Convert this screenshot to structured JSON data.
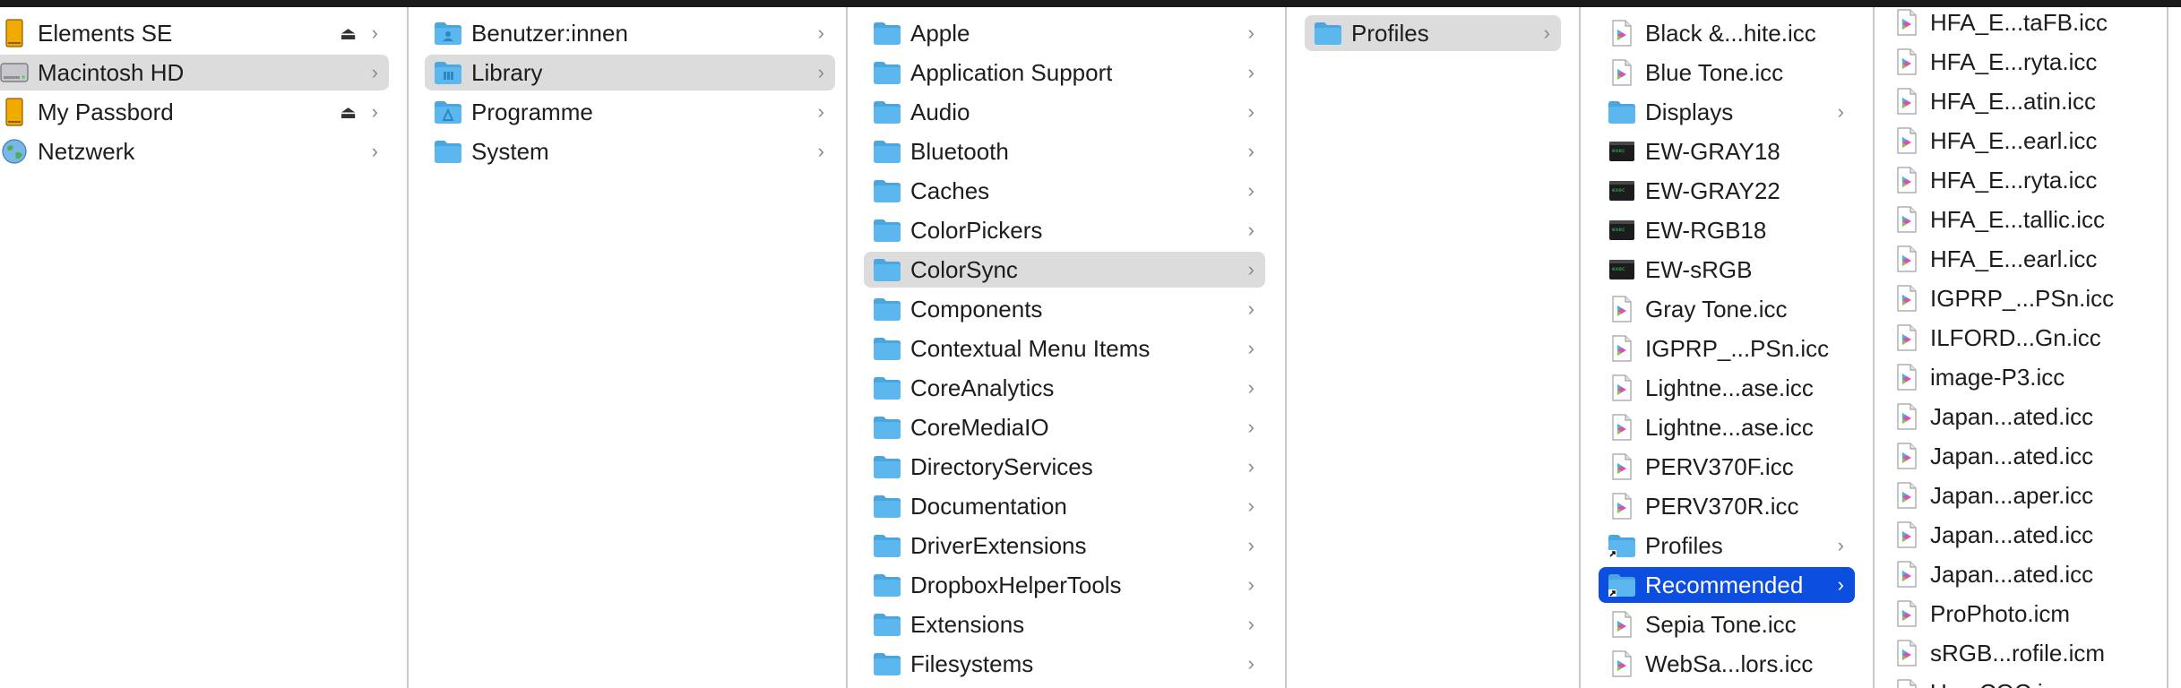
{
  "colors": {
    "accent": "#0b4ee0",
    "selection_gray": "#dcdcdc",
    "folder_blue": "#5cb7ee",
    "folder_tab": "#4aa6de"
  },
  "column1": {
    "items": [
      {
        "label": "Elements SE",
        "icon": "external-drive-icon",
        "eject": "⏏",
        "chevron": "›"
      },
      {
        "label": "Macintosh HD",
        "icon": "internal-disk-icon",
        "chevron": "›",
        "selected": true
      },
      {
        "label": "My Passbord",
        "icon": "external-drive-icon",
        "eject": "⏏",
        "chevron": "›"
      },
      {
        "label": "Netzwerk",
        "icon": "network-globe-icon",
        "chevron": "›"
      }
    ]
  },
  "column2": {
    "items": [
      {
        "label": "Benutzer:innen",
        "icon": "users-folder-icon",
        "chevron": "›"
      },
      {
        "label": "Library",
        "icon": "library-folder-icon",
        "chevron": "›",
        "selected": true
      },
      {
        "label": "Programme",
        "icon": "applications-folder-icon",
        "chevron": "›"
      },
      {
        "label": "System",
        "icon": "system-folder-icon",
        "chevron": "›"
      }
    ]
  },
  "column3": {
    "items": [
      {
        "label": "Apple",
        "chevron": "›"
      },
      {
        "label": "Application Support",
        "chevron": "›"
      },
      {
        "label": "Audio",
        "chevron": "›"
      },
      {
        "label": "Bluetooth",
        "chevron": "›"
      },
      {
        "label": "Caches",
        "chevron": "›"
      },
      {
        "label": "ColorPickers",
        "chevron": "›"
      },
      {
        "label": "ColorSync",
        "chevron": "›",
        "selected": true
      },
      {
        "label": "Components",
        "chevron": "›"
      },
      {
        "label": "Contextual Menu Items",
        "chevron": "›"
      },
      {
        "label": "CoreAnalytics",
        "chevron": "›"
      },
      {
        "label": "CoreMediaIO",
        "chevron": "›"
      },
      {
        "label": "DirectoryServices",
        "chevron": "›"
      },
      {
        "label": "Documentation",
        "chevron": "›"
      },
      {
        "label": "DriverExtensions",
        "chevron": "›"
      },
      {
        "label": "DropboxHelperTools",
        "chevron": "›"
      },
      {
        "label": "Extensions",
        "chevron": "›"
      },
      {
        "label": "Filesystems",
        "chevron": "›"
      }
    ]
  },
  "column4": {
    "items": [
      {
        "label": "Profiles",
        "chevron": "›",
        "selected": true
      }
    ]
  },
  "column5": {
    "items": [
      {
        "label": "Black &...hite.icc",
        "icon": "icc-profile-icon"
      },
      {
        "label": "Blue Tone.icc",
        "icon": "icc-profile-icon"
      },
      {
        "label": "Displays",
        "icon": "folder-icon",
        "chevron": "›"
      },
      {
        "label": "EW-GRAY18",
        "icon": "terminal-exec-icon"
      },
      {
        "label": "EW-GRAY22",
        "icon": "terminal-exec-icon"
      },
      {
        "label": "EW-RGB18",
        "icon": "terminal-exec-icon"
      },
      {
        "label": "EW-sRGB",
        "icon": "terminal-exec-icon"
      },
      {
        "label": "Gray Tone.icc",
        "icon": "icc-profile-icon"
      },
      {
        "label": "IGPRP_...PSn.icc",
        "icon": "icc-profile-icon"
      },
      {
        "label": "Lightne...ase.icc",
        "icon": "icc-profile-icon"
      },
      {
        "label": "Lightne...ase.icc",
        "icon": "icc-profile-icon"
      },
      {
        "label": "PERV370F.icc",
        "icon": "icc-profile-icon"
      },
      {
        "label": "PERV370R.icc",
        "icon": "icc-profile-icon"
      },
      {
        "label": "Profiles",
        "icon": "alias-folder-icon",
        "chevron": "›"
      },
      {
        "label": "Recommended",
        "icon": "alias-folder-icon",
        "chevron": "›",
        "selected": true
      },
      {
        "label": "Sepia Tone.icc",
        "icon": "icc-profile-icon"
      },
      {
        "label": "WebSa...lors.icc",
        "icon": "icc-profile-icon"
      }
    ]
  },
  "column6": {
    "items": [
      {
        "label": "HFA_E...taFB.icc"
      },
      {
        "label": "HFA_E...ryta.icc"
      },
      {
        "label": "HFA_E...atin.icc"
      },
      {
        "label": "HFA_E...earl.icc"
      },
      {
        "label": "HFA_E...ryta.icc"
      },
      {
        "label": "HFA_E...tallic.icc"
      },
      {
        "label": "HFA_E...earl.icc"
      },
      {
        "label": "IGPRP_...PSn.icc"
      },
      {
        "label": "ILFORD...Gn.icc"
      },
      {
        "label": "image-P3.icc"
      },
      {
        "label": "Japan...ated.icc"
      },
      {
        "label": "Japan...ated.icc"
      },
      {
        "label": "Japan...aper.icc"
      },
      {
        "label": "Japan...ated.icc"
      },
      {
        "label": "Japan...ated.icc"
      },
      {
        "label": "ProPhoto.icm"
      },
      {
        "label": "sRGB...rofile.icm"
      },
      {
        "label": "U.....COC.icc"
      }
    ]
  }
}
